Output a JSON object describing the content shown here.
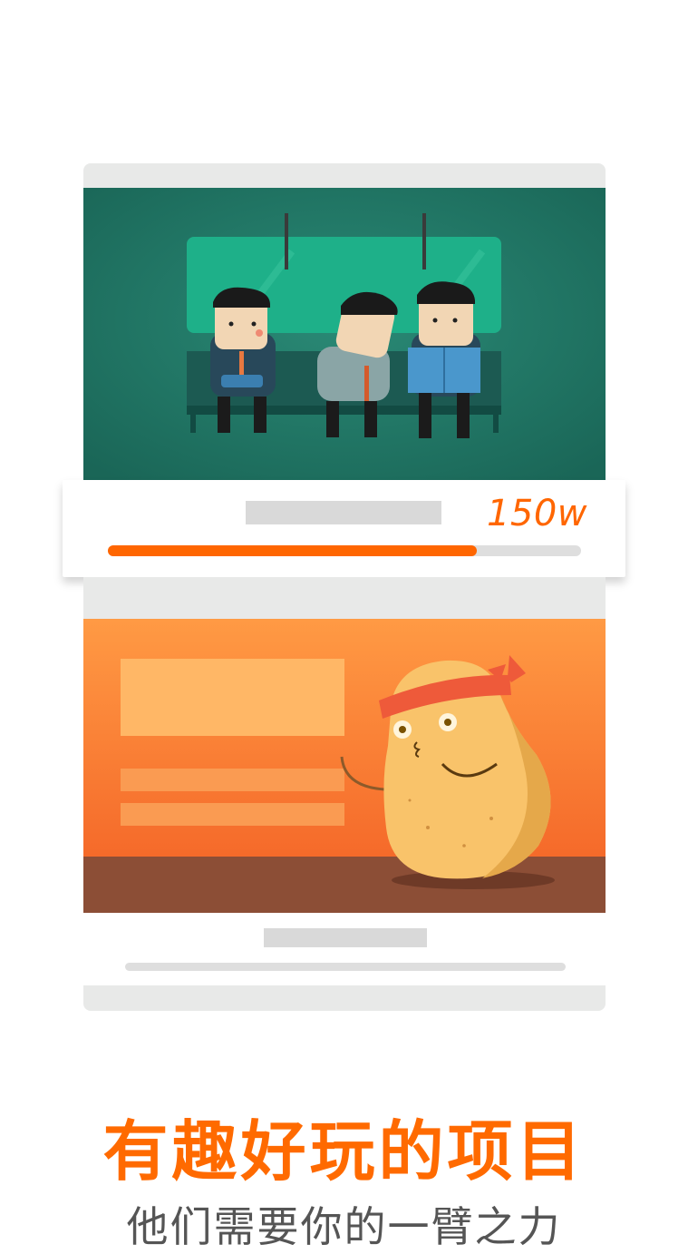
{
  "progress_card": {
    "count": "150w",
    "progress_fraction": 0.78
  },
  "headline": "有趣好玩的项目",
  "tagline": "他们需要你的一臂之力",
  "colors": {
    "accent": "#ff6600",
    "subway_bg": "#1f7a6a",
    "potato_bg": "#f7883a"
  },
  "illustrations": {
    "top": "subway-commuters-illustration",
    "bottom": "potato-mascot-illustration"
  }
}
